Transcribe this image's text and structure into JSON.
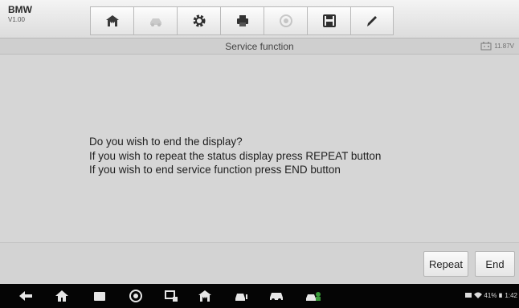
{
  "app": {
    "name": "BMW",
    "version": "V1.00"
  },
  "toolbar": {
    "buttons": [
      {
        "icon": "home-icon",
        "state": "enabled"
      },
      {
        "icon": "vehicle-swap-icon",
        "state": "disabled"
      },
      {
        "icon": "gear-icon",
        "state": "enabled"
      },
      {
        "icon": "print-icon",
        "state": "enabled"
      },
      {
        "icon": "help-icon",
        "state": "disabled"
      },
      {
        "icon": "save-icon",
        "state": "enabled"
      },
      {
        "icon": "edit-icon",
        "state": "enabled"
      }
    ]
  },
  "title": "Service function",
  "battery_voltage": "11.87V",
  "message": {
    "line1": "Do you wish to end the display?",
    "line2": "If you wish to repeat the status display press REPEAT button",
    "line3": "If you wish to end service function press END button"
  },
  "actions": {
    "repeat_label": "Repeat",
    "end_label": "End"
  },
  "navbar": {
    "icons": [
      "back-icon",
      "home-icon",
      "recent-apps-icon",
      "browser-icon",
      "remote-icon",
      "diagnostic-home-icon",
      "vehicle-icon",
      "car-icon",
      "service-icon"
    ]
  },
  "status_bar": {
    "battery_percent": "41%",
    "time": "1:42"
  }
}
